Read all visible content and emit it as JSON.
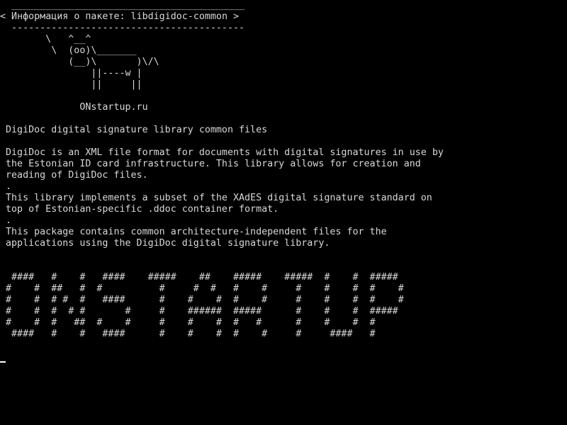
{
  "cowsay": {
    "border_top": " _________________________________________",
    "message": "< Информация о пакете: libdigidoc-common >",
    "border_bottom": " -----------------------------------------",
    "cow": [
      "       \\   ^__^",
      "        \\  (oo)\\_______",
      "           (__)\\       )\\/\\",
      "               ||----w |",
      "               ||     ||"
    ]
  },
  "site": "             ONstartup.ru",
  "summary": "DigiDoc digital signature library common files",
  "description": [
    "DigiDoc is an XML file format for documents with digital signatures in use by",
    "the Estonian ID card infrastructure. This library allows for creation and",
    "reading of DigiDoc files.",
    ".",
    "This library implements a subset of the XAdES digital signature standard on",
    "top of Estonian-specific .ddoc container format.",
    ".",
    "This package contains common architecture-independent files for the",
    "applications using the DigiDoc digital signature library."
  ],
  "banner": [
    " ####   #    #   ####    #####    ##    #####    #####  #    #  #####",
    "#    #  ##   #  #          #     #  #   #    #     #    #    #  #    #",
    "#    #  # #  #   ####      #    #    #  #    #     #    #    #  #    #",
    "#    #  #  # #       #     #    ######  #####      #    #    #  #####",
    "#    #  #   ##  #    #     #    #    #  #   #      #    #    #  #",
    " ####   #    #   ####      #    #    #  #    #     #     ####   #"
  ]
}
